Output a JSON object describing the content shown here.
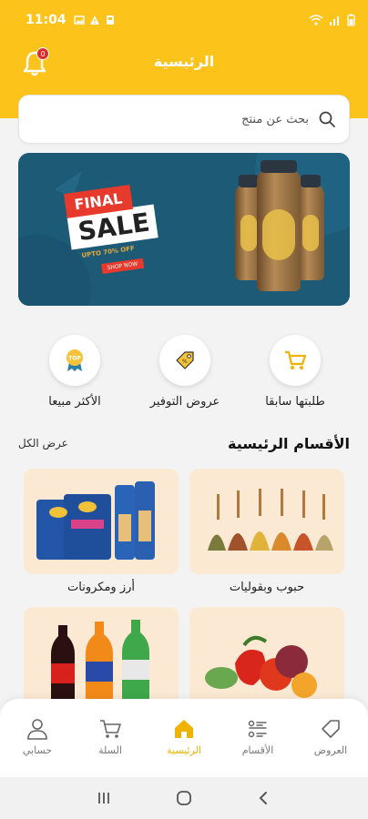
{
  "status_bar": {
    "time": "11:04"
  },
  "header": {
    "title": "الرئيسية",
    "notification_count": "0"
  },
  "search": {
    "placeholder": "بحث عن منتج"
  },
  "banner": {
    "line1": "FINAL",
    "line2": "SALE",
    "line3": "UPTO 70% OFF",
    "button": "SHOP NOW"
  },
  "quick_links": [
    {
      "label": "طلبتها سابقا",
      "icon": "cart-icon"
    },
    {
      "label": "عروض التوفير",
      "icon": "price-tag-icon"
    },
    {
      "label": "الأكثر مبيعا",
      "icon": "top-badge-icon",
      "icon_text": "TOP"
    }
  ],
  "sections": {
    "main_categories_title": "الأقسام الرئيسية",
    "view_all": "عرض الكل"
  },
  "categories": [
    {
      "label": "حبوب وبقوليات",
      "image": "grains-image"
    },
    {
      "label": "أرز ومكرونات",
      "image": "pasta-image"
    },
    {
      "label": "",
      "image": "vegetables-image"
    },
    {
      "label": "",
      "image": "soft-drinks-image"
    }
  ],
  "bottom_nav": [
    {
      "label": "العروض",
      "icon": "tag-icon"
    },
    {
      "label": "الأقسام",
      "icon": "list-icon"
    },
    {
      "label": "الرئيسية",
      "icon": "home-icon",
      "active": true
    },
    {
      "label": "السلة",
      "icon": "cart-icon"
    },
    {
      "label": "حسابي",
      "icon": "user-icon"
    }
  ],
  "colors": {
    "primary": "#fcc31b",
    "active_nav": "#f0b400",
    "badge": "#e02b2b",
    "banner_bg": "#1c5a76"
  }
}
